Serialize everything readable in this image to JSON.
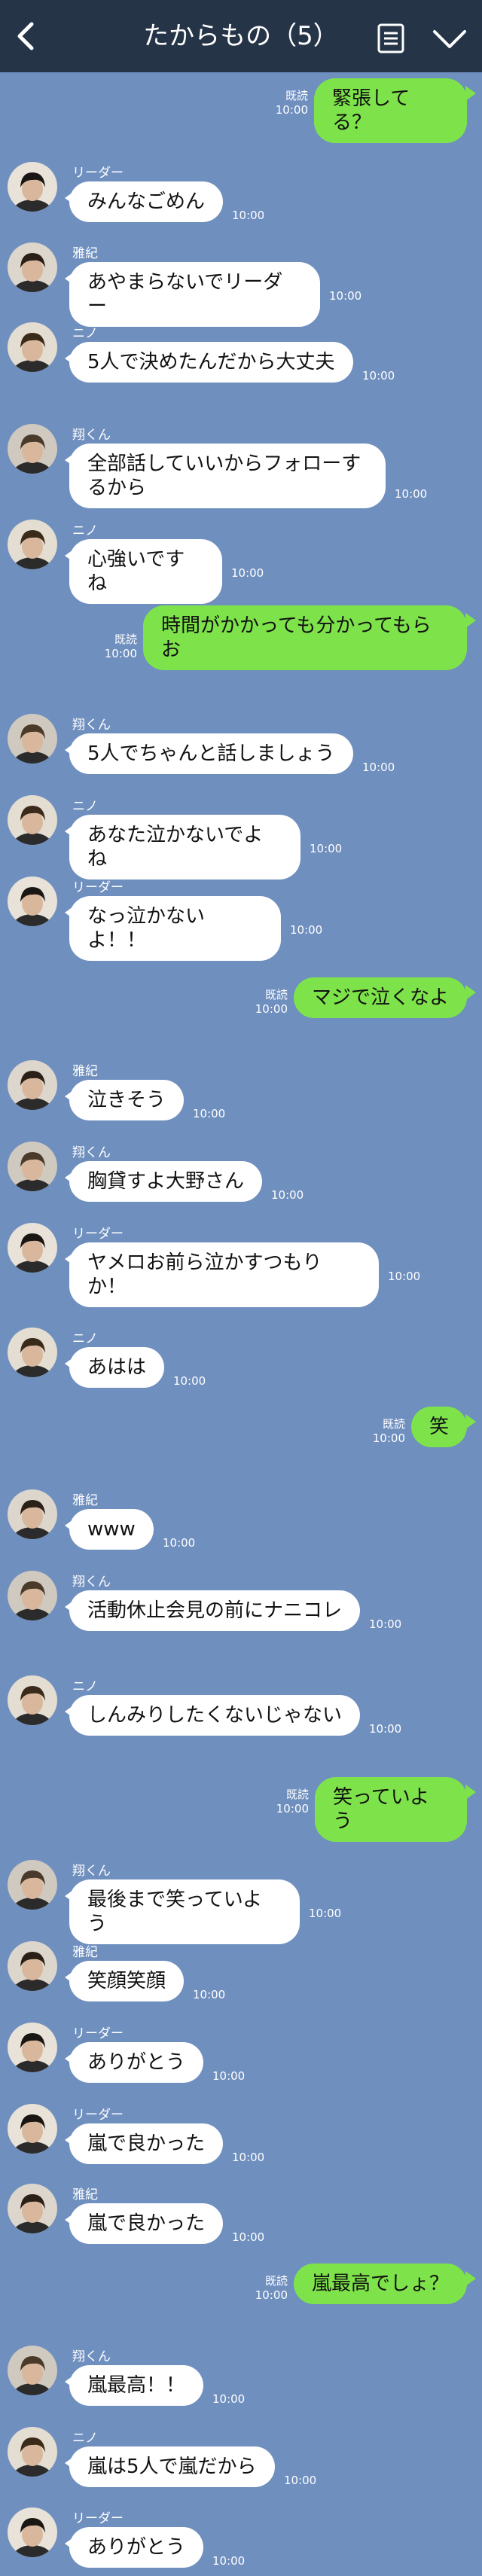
{
  "header": {
    "title": "たからもの（5）",
    "back_icon": "chevron-left-icon",
    "menu_icon": "note-icon",
    "toggle_icon": "chevron-down-icon",
    "bg_color": "#263448"
  },
  "colors": {
    "background": "#6f8fbf",
    "incoming_bubble": "#ffffff",
    "outgoing_bubble": "#7ee34a"
  },
  "messages": [
    {
      "dir": "out",
      "read": "既読",
      "time": "10:00",
      "text": "緊張してる？"
    },
    {
      "dir": "in",
      "sender": "リーダー",
      "text": "みんなごめん",
      "time": "10:00"
    },
    {
      "dir": "in",
      "sender": "雅紀",
      "text": "あやまらないでリーダー",
      "time": "10:00"
    },
    {
      "dir": "in",
      "sender": "ニノ",
      "text": "5人で決めたんだから大丈夫",
      "time": "10:00"
    },
    {
      "dir": "in",
      "sender": "翔くん",
      "text": "全部話していいからフォローするから",
      "time": "10:00"
    },
    {
      "dir": "in",
      "sender": "ニノ",
      "text": "心強いですね",
      "time": "10:00"
    },
    {
      "dir": "out",
      "read": "既読",
      "time": "10:00",
      "text": "時間がかかっても分かってもらお"
    },
    {
      "dir": "in",
      "sender": "翔くん",
      "text": "5人でちゃんと話しましょう",
      "time": "10:00"
    },
    {
      "dir": "in",
      "sender": "ニノ",
      "text": "あなた泣かないでよね",
      "time": "10:00"
    },
    {
      "dir": "in",
      "sender": "リーダー",
      "text": "なっ泣かないよ！！",
      "time": "10:00"
    },
    {
      "dir": "out",
      "read": "既読",
      "time": "10:00",
      "text": "マジで泣くなよ"
    },
    {
      "dir": "in",
      "sender": "雅紀",
      "text": "泣きそう",
      "time": "10:00"
    },
    {
      "dir": "in",
      "sender": "翔くん",
      "text": "胸貸すよ大野さん",
      "time": "10:00"
    },
    {
      "dir": "in",
      "sender": "リーダー",
      "text": "ヤメロお前ら泣かすつもりか！",
      "time": "10:00"
    },
    {
      "dir": "in",
      "sender": "ニノ",
      "text": "あはは",
      "time": "10:00"
    },
    {
      "dir": "out",
      "read": "既読",
      "time": "10:00",
      "text": "笑"
    },
    {
      "dir": "in",
      "sender": "雅紀",
      "text": "www",
      "time": "10:00"
    },
    {
      "dir": "in",
      "sender": "翔くん",
      "text": "活動休止会見の前にナニコレ",
      "time": "10:00"
    },
    {
      "dir": "in",
      "sender": "ニノ",
      "text": "しんみりしたくないじゃない",
      "time": "10:00"
    },
    {
      "dir": "out",
      "read": "既読",
      "time": "10:00",
      "text": "笑っていよう"
    },
    {
      "dir": "in",
      "sender": "翔くん",
      "text": "最後まで笑っていよう",
      "time": "10:00"
    },
    {
      "dir": "in",
      "sender": "雅紀",
      "text": "笑顔笑顔",
      "time": "10:00"
    },
    {
      "dir": "in",
      "sender": "リーダー",
      "text": "ありがとう",
      "time": "10:00"
    },
    {
      "dir": "in",
      "sender": "リーダー",
      "text": "嵐で良かった",
      "time": "10:00"
    },
    {
      "dir": "in",
      "sender": "雅紀",
      "text": "嵐で良かった",
      "time": "10:00"
    },
    {
      "dir": "out",
      "read": "既読",
      "time": "10:00",
      "text": "嵐最高でしょ？"
    },
    {
      "dir": "in",
      "sender": "翔くん",
      "text": "嵐最高！！",
      "time": "10:00"
    },
    {
      "dir": "in",
      "sender": "ニノ",
      "text": "嵐は5人で嵐だから",
      "time": "10:00"
    },
    {
      "dir": "in",
      "sender": "リーダー",
      "text": "ありがとう",
      "time": "10:00"
    }
  ]
}
